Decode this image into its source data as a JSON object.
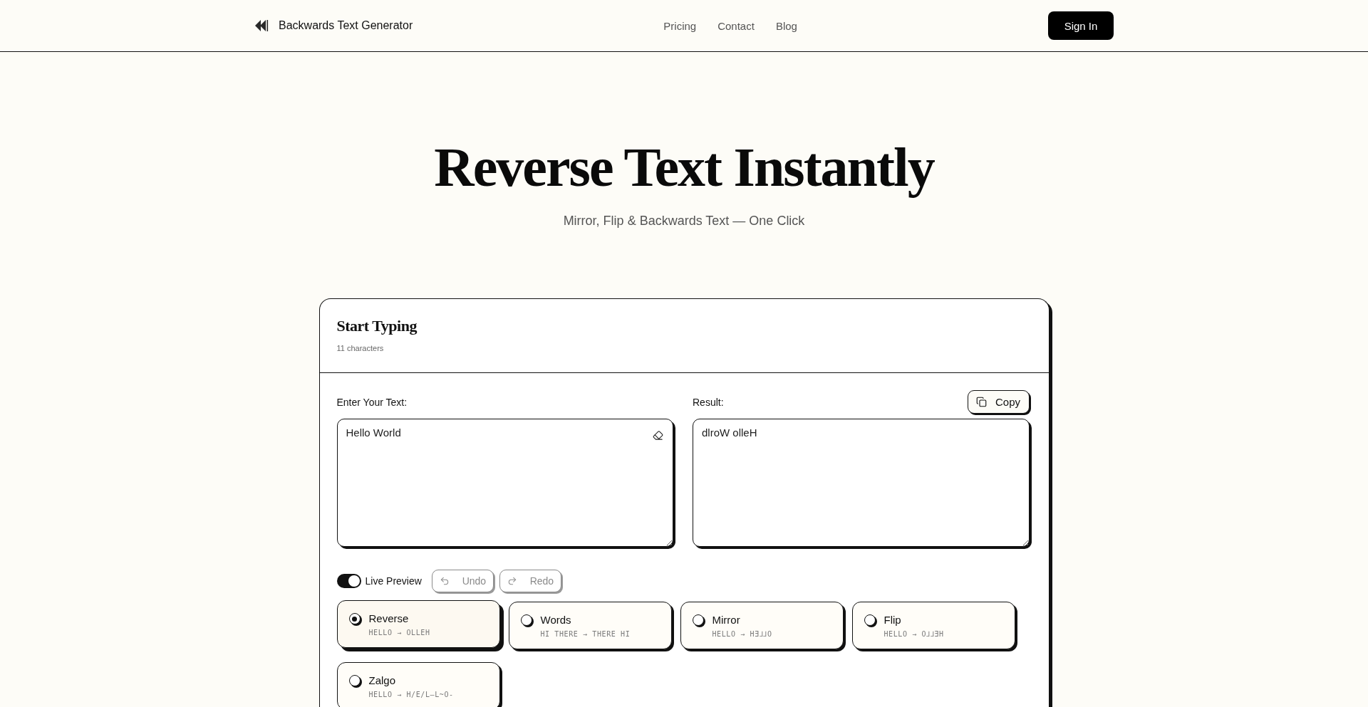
{
  "header": {
    "brand": "Backwards Text Generator",
    "nav": [
      "Pricing",
      "Contact",
      "Blog"
    ],
    "sign_in": "Sign In"
  },
  "hero": {
    "title": "Reverse Text Instantly",
    "subtitle": "Mirror, Flip & Backwards Text — One Click"
  },
  "editor": {
    "title": "Start Typing",
    "char_count": "11 characters",
    "input": {
      "label": "Enter Your Text:",
      "value": "Hello World"
    },
    "result": {
      "label": "Result:",
      "value": "dlroW olleH",
      "copy_button": "Copy"
    },
    "live_preview": {
      "label": "Live Preview",
      "on": true
    },
    "history": [
      {
        "kind": "undo",
        "label": "Undo",
        "disabled": true
      },
      {
        "kind": "redo",
        "label": "Redo",
        "disabled": true
      }
    ],
    "modes": [
      {
        "name": "Reverse",
        "example": "HELLO → OLLEH",
        "selected": true
      },
      {
        "name": "Words",
        "example": "HI THERE → THERE HI",
        "selected": false
      },
      {
        "name": "Mirror",
        "example": "HELLO → HƎ⅃⅃O",
        "selected": false
      },
      {
        "name": "Flip",
        "example": "HELLO → O⅃⅃ƎH",
        "selected": false
      },
      {
        "name": "Zalgo",
        "example": "HELLO → H/E/L—L~O-",
        "selected": false
      }
    ]
  }
}
